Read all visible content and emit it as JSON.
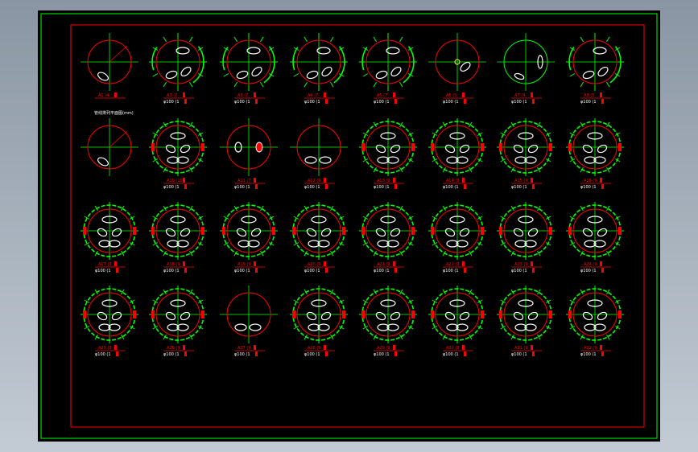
{
  "colors": {
    "background": "#000000",
    "frame_outer": "#00ff00",
    "frame_inner": "#ff0000",
    "centerline": "#00ff00",
    "circle": "#ff0000",
    "hole": "#ffffff",
    "dimension": "#00ff00",
    "tag_red": "#ff0000",
    "tag_white": "#ffffff"
  },
  "note": "管线排列平面图(mm)",
  "drawings": [
    {
      "id": "A1",
      "variant": "topview",
      "label1": "A1 (4",
      "label2": ""
    },
    {
      "id": "A2",
      "variant": "partial",
      "label1": "A2 (7",
      "label2": "φ100 (1"
    },
    {
      "id": "A3",
      "variant": "partial",
      "label1": "A3 (7",
      "label2": "φ100 (1"
    },
    {
      "id": "A4",
      "variant": "partial",
      "label1": "A4 (7",
      "label2": "φ100 (1"
    },
    {
      "id": "A5",
      "variant": "partial",
      "label1": "A5 (7",
      "label2": "φ100 (1"
    },
    {
      "id": "A6",
      "variant": "small",
      "label1": "A6 (5",
      "label2": "φ100 (1"
    },
    {
      "id": "A7",
      "variant": "green",
      "label1": "A7 (4",
      "label2": "φ100 (1"
    },
    {
      "id": "A8",
      "variant": "partialR",
      "label1": "A8 (5",
      "label2": "φ100 (1"
    },
    {
      "id": "A9",
      "variant": "plain",
      "label1": "",
      "label2": ""
    },
    {
      "id": "A10",
      "variant": "full",
      "label1": "A10 (10",
      "label2": "φ100 (1"
    },
    {
      "id": "A11",
      "variant": "twohole",
      "label1": "A11 (7",
      "label2": "φ100 (1"
    },
    {
      "id": "A12",
      "variant": "half",
      "label1": "A12 (9",
      "label2": "φ100 (1"
    },
    {
      "id": "A13",
      "variant": "full",
      "label1": "A13 (9",
      "label2": "φ100 (1"
    },
    {
      "id": "A14",
      "variant": "full",
      "label1": "A14 (9",
      "label2": "φ100 (1"
    },
    {
      "id": "A15",
      "variant": "full",
      "label1": "A15 (9",
      "label2": "φ100 (1"
    },
    {
      "id": "A16",
      "variant": "full",
      "label1": "A16 (9",
      "label2": "φ100 (1"
    },
    {
      "id": "A17",
      "variant": "full",
      "label1": "A17 (9",
      "label2": "φ100 (1"
    },
    {
      "id": "A18",
      "variant": "full",
      "label1": "A18 (9",
      "label2": "φ100 (1"
    },
    {
      "id": "A19",
      "variant": "full",
      "label1": "A19 (9",
      "label2": "φ100 (1"
    },
    {
      "id": "A20",
      "variant": "full",
      "label1": "A20 (9",
      "label2": "φ100 (1"
    },
    {
      "id": "A21",
      "variant": "full",
      "label1": "A21 (9",
      "label2": "φ100 (1"
    },
    {
      "id": "A22",
      "variant": "full",
      "label1": "A22 (9",
      "label2": "φ100 (1"
    },
    {
      "id": "A23",
      "variant": "full",
      "label1": "A23 (9",
      "label2": "φ100 (1"
    },
    {
      "id": "A24",
      "variant": "full",
      "label1": "A24 (9",
      "label2": "φ100 (1"
    },
    {
      "id": "A25",
      "variant": "full",
      "label1": "A25 (9",
      "label2": "φ100 (1"
    },
    {
      "id": "A26",
      "variant": "full",
      "label1": "A26 (9",
      "label2": "φ100 (1"
    },
    {
      "id": "A27",
      "variant": "half",
      "label1": "A27 (9",
      "label2": "φ100 (1"
    },
    {
      "id": "A28",
      "variant": "full",
      "label1": "A28 (9",
      "label2": "φ100 (1"
    },
    {
      "id": "A29",
      "variant": "full",
      "label1": "A29 (9",
      "label2": "φ100 (1"
    },
    {
      "id": "A30",
      "variant": "full",
      "label1": "A30 (9",
      "label2": "φ100 (1"
    },
    {
      "id": "A31",
      "variant": "full",
      "label1": "A31 (9",
      "label2": "φ100 (1"
    },
    {
      "id": "A32",
      "variant": "full",
      "label1": "A32 (9",
      "label2": "φ100 (1"
    }
  ]
}
